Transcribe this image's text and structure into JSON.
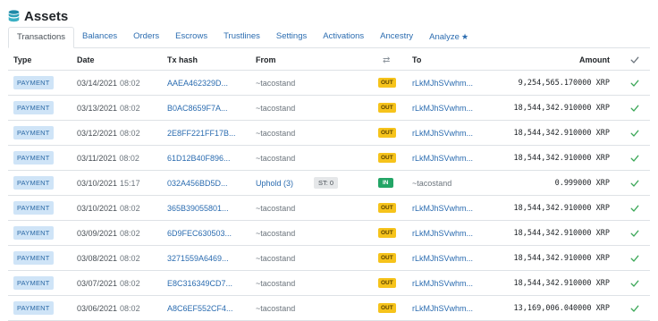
{
  "header": {
    "title": "Assets",
    "icon": "database-icon"
  },
  "tabs": [
    {
      "label": "Transactions",
      "active": true
    },
    {
      "label": "Balances"
    },
    {
      "label": "Orders"
    },
    {
      "label": "Escrows"
    },
    {
      "label": "Trustlines"
    },
    {
      "label": "Settings"
    },
    {
      "label": "Activations"
    },
    {
      "label": "Ancestry"
    },
    {
      "label": "Analyze",
      "icon": "star"
    }
  ],
  "columns": {
    "type": "Type",
    "date": "Date",
    "hash": "Tx hash",
    "from": "From",
    "dir_icon": "⇄",
    "to": "To",
    "amount": "Amount"
  },
  "rows": [
    {
      "type": "PAYMENT",
      "date": "03/14/2021",
      "time": "08:02",
      "hash": "AAEA462329D...",
      "from": "~tacostand",
      "st": "",
      "dir": "OUT",
      "to": "rLkMJhSVwhm...",
      "amount": "9,254,565.170000 XRP"
    },
    {
      "type": "PAYMENT",
      "date": "03/13/2021",
      "time": "08:02",
      "hash": "B0AC8659F7A...",
      "from": "~tacostand",
      "st": "",
      "dir": "OUT",
      "to": "rLkMJhSVwhm...",
      "amount": "18,544,342.910000 XRP"
    },
    {
      "type": "PAYMENT",
      "date": "03/12/2021",
      "time": "08:02",
      "hash": "2E8FF221FF17B...",
      "from": "~tacostand",
      "st": "",
      "dir": "OUT",
      "to": "rLkMJhSVwhm...",
      "amount": "18,544,342.910000 XRP"
    },
    {
      "type": "PAYMENT",
      "date": "03/11/2021",
      "time": "08:02",
      "hash": "61D12B40F896...",
      "from": "~tacostand",
      "st": "",
      "dir": "OUT",
      "to": "rLkMJhSVwhm...",
      "amount": "18,544,342.910000 XRP"
    },
    {
      "type": "PAYMENT",
      "date": "03/10/2021",
      "time": "15:17",
      "hash": "032A456BD5D...",
      "from": "Uphold (3)",
      "st": "ST: 0",
      "dir": "IN",
      "to": "~tacostand",
      "amount": "0.999000 XRP"
    },
    {
      "type": "PAYMENT",
      "date": "03/10/2021",
      "time": "08:02",
      "hash": "365B39055801...",
      "from": "~tacostand",
      "st": "",
      "dir": "OUT",
      "to": "rLkMJhSVwhm...",
      "amount": "18,544,342.910000 XRP"
    },
    {
      "type": "PAYMENT",
      "date": "03/09/2021",
      "time": "08:02",
      "hash": "6D9FEC630503...",
      "from": "~tacostand",
      "st": "",
      "dir": "OUT",
      "to": "rLkMJhSVwhm...",
      "amount": "18,544,342.910000 XRP"
    },
    {
      "type": "PAYMENT",
      "date": "03/08/2021",
      "time": "08:02",
      "hash": "3271559A6469...",
      "from": "~tacostand",
      "st": "",
      "dir": "OUT",
      "to": "rLkMJhSVwhm...",
      "amount": "18,544,342.910000 XRP"
    },
    {
      "type": "PAYMENT",
      "date": "03/07/2021",
      "time": "08:02",
      "hash": "E8C316349CD7...",
      "from": "~tacostand",
      "st": "",
      "dir": "OUT",
      "to": "rLkMJhSVwhm...",
      "amount": "18,544,342.910000 XRP"
    },
    {
      "type": "PAYMENT",
      "date": "03/06/2021",
      "time": "08:02",
      "hash": "A8C6EF552CF4...",
      "from": "~tacostand",
      "st": "",
      "dir": "OUT",
      "to": "rLkMJhSVwhm...",
      "amount": "13,169,006.040000 XRP"
    }
  ],
  "colors": {
    "link": "#2b6cb0",
    "out": "#f6c31b",
    "in": "#23a566",
    "check": "#3aa757"
  }
}
